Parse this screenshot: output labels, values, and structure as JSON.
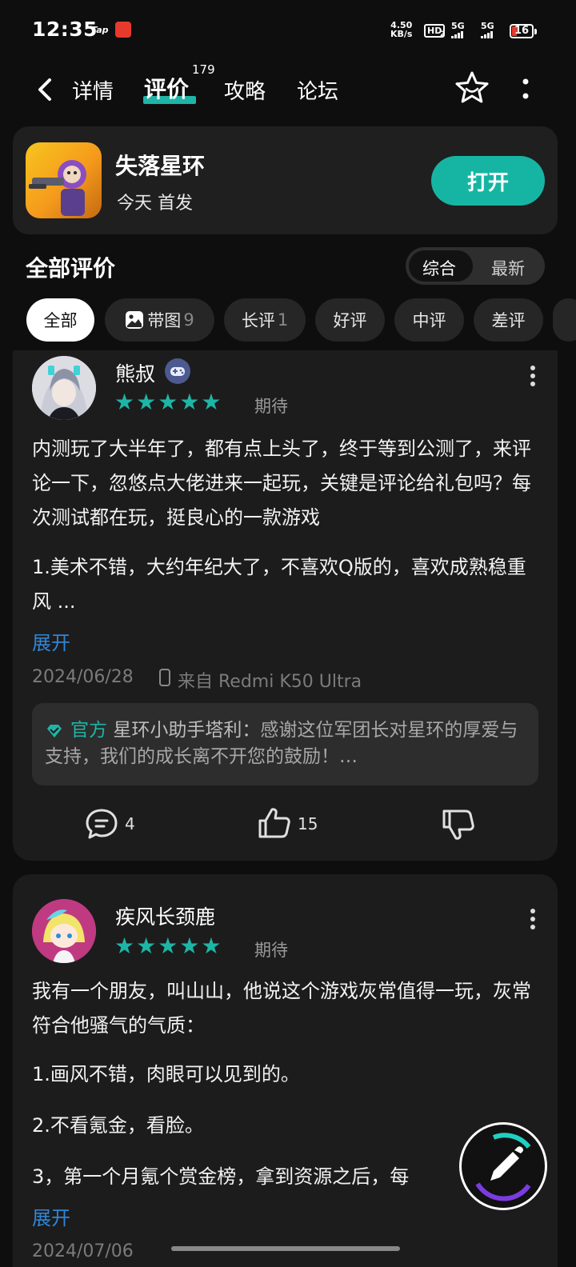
{
  "status_bar": {
    "time": "12:35",
    "tap_label": "Tap",
    "net_speed_value": "4.50",
    "net_speed_unit": "KB/s",
    "hd_label": "HD",
    "hd_sub": "2",
    "sig1_label": "5G",
    "sig2_label": "5G",
    "battery": "16"
  },
  "nav": {
    "tabs": [
      {
        "label": "详情"
      },
      {
        "label": "评价"
      },
      {
        "label": "攻略"
      },
      {
        "label": "论坛"
      }
    ],
    "review_count": "179"
  },
  "game": {
    "title": "失落星环",
    "subtitle": "今天 首发",
    "open_label": "打开"
  },
  "reviews_header": {
    "title": "全部评价",
    "sort_options": [
      "综合",
      "最新"
    ]
  },
  "filters": [
    {
      "label": "全部"
    },
    {
      "label": "带图",
      "count": "9"
    },
    {
      "label": "长评",
      "count": "1"
    },
    {
      "label": "好评"
    },
    {
      "label": "中评"
    },
    {
      "label": "差评"
    }
  ],
  "reviews": [
    {
      "username": "熊叔",
      "rating": 5,
      "stars": "★★★★★",
      "tag": "期待",
      "paragraphs": [
        "内测玩了大半年了，都有点上头了，终于等到公测了，来评论一下，忽悠点大佬进来一起玩，关键是评论给礼包吗？每次测试都在玩，挺良心的一款游戏",
        "1.美术不错，大约年纪大了，不喜欢Q版的，喜欢成熟稳重风 ..."
      ],
      "expand": "展开",
      "date": "2024/06/28",
      "device": "来自 Redmi K50 Ultra",
      "official_reply": {
        "badge": "官方",
        "author": "星环小助手塔利：",
        "text": "感谢这位军团长对星环的厚爱与支持，我们的成长离不开您的鼓励！…"
      },
      "comments": "4",
      "likes": "15"
    },
    {
      "username": "疾风长颈鹿",
      "rating": 5,
      "stars": "★★★★★",
      "tag": "期待",
      "paragraphs": [
        "我有一个朋友，叫山山，他说这个游戏灰常值得一玩，灰常符合他骚气的气质：",
        "1.画风不错，肉眼可以见到的。",
        "2.不看氪金，看脸。",
        "3，第一个月氪个赏金榜，拿到资源之后，每"
      ],
      "expand": "展开",
      "date": "2024/07/06"
    }
  ]
}
